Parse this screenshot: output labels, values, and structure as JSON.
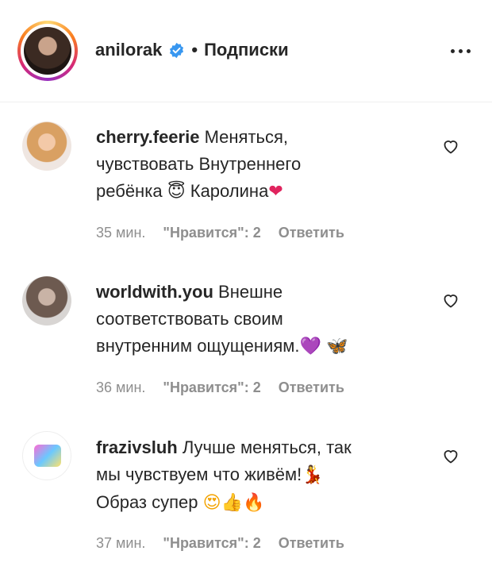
{
  "header": {
    "username": "anilorak",
    "separator": "•",
    "follow_label": "Подписки",
    "more_icon": "more-horizontal-icon",
    "verified_icon": "verified-badge-icon",
    "verified_color": "#3897f0"
  },
  "comments": [
    {
      "username": "cherry.feerie",
      "text_line1": "Меняться,",
      "text_line2": "чувствовать Внутреннего",
      "text_line3": "ребёнка",
      "emoji_a": "😇",
      "text_tail": "Каролина",
      "emoji_b": "❤",
      "time": "35 мин.",
      "likes": "\"Нравится\": 2",
      "reply": "Ответить"
    },
    {
      "username": "worldwith.you",
      "text_line1": "Внешне",
      "text_line2": "соответствовать своим",
      "text_line3": "внутренним ощущениям.",
      "emoji_a": "💜",
      "emoji_b": "🦋",
      "time": "36 мин.",
      "likes": "\"Нравится\": 2",
      "reply": "Ответить"
    },
    {
      "username": "frazivsluh",
      "text_line1": "Лучше меняться, так",
      "text_line2": "мы чувствуем что живём!",
      "emoji_a": "💃",
      "text_line3": "Образ супер",
      "emoji_b": "😍👍🔥",
      "time": "37 мин.",
      "likes": "\"Нравится\": 2",
      "reply": "Ответить"
    }
  ]
}
